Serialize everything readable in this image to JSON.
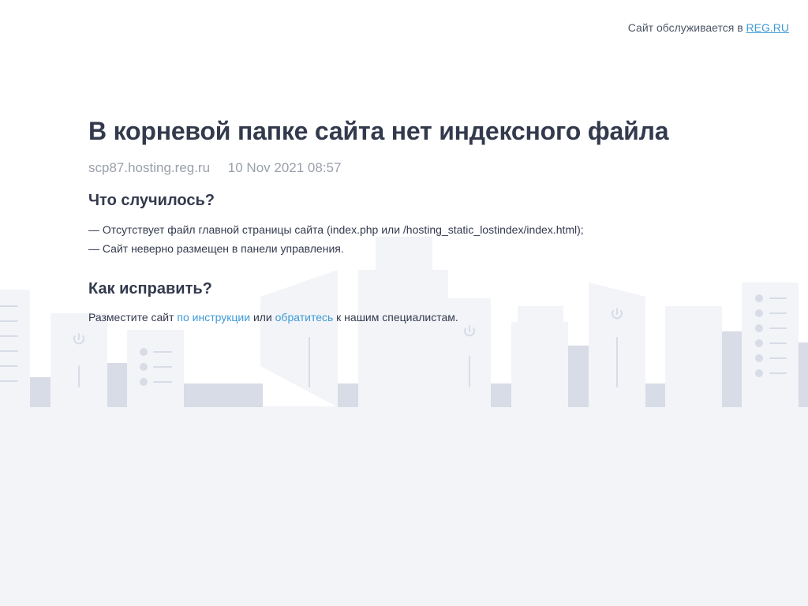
{
  "topbar": {
    "prefix": "Сайт обслуживается в",
    "link": "REG.RU"
  },
  "main": {
    "title": "В корневой папке сайта нет индексного файла",
    "host": "scp87.hosting.reg.ru",
    "datetime": "10 Nov 2021 08:57",
    "what_heading": "Что случилось?",
    "issues": [
      "— Отсутствует файл главной страницы сайта (index.php или /hosting_static_lostindex/index.html);",
      "— Сайт неверно размещен в панели управления."
    ],
    "how_heading": "Как исправить?",
    "fix": {
      "text_before": "Разместите сайт",
      "link_instructions": "по инструкции",
      "text_middle": "или",
      "link_contact": "обратитесь",
      "text_after": "к нашим специалистам."
    }
  },
  "colors": {
    "background": "#ffffff",
    "skyline_light": "#f2f4f8",
    "skyline_dark": "#d7dce6",
    "title": "#333a4d",
    "meta": "#9aa0ab",
    "link": "#3d9ad6"
  }
}
